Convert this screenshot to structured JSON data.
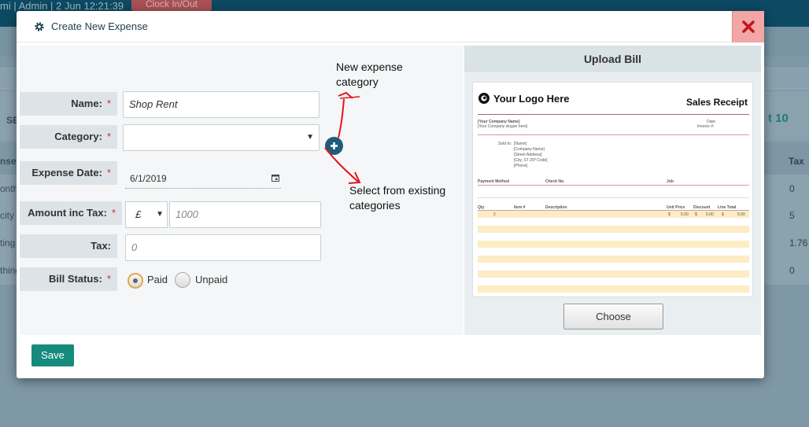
{
  "background": {
    "topbar_text": "mi | Admin | 2 Jun 12:21:39",
    "clock_label": "Clock In/Out",
    "left_fragments": [
      "SE",
      "nse",
      "onth",
      "city",
      "ting",
      "thing"
    ],
    "right_header": "Tax",
    "right_values": [
      "0",
      "5",
      "1.76",
      "0"
    ],
    "stat_fragment": "t 10"
  },
  "modal": {
    "title": "Create New Expense",
    "close_icon": "close-x-icon"
  },
  "form": {
    "name_label": "Name:",
    "name_value": "Shop Rent",
    "category_label": "Category:",
    "category_value": "",
    "date_label": "Expense Date:",
    "date_value": "6/1/2019",
    "amount_label": "Amount inc Tax:",
    "currency_symbol": "£",
    "amount_placeholder": "1000",
    "tax_label": "Tax:",
    "tax_placeholder": "0",
    "status_label": "Bill Status:",
    "status_options": [
      "Paid",
      "Unpaid"
    ],
    "status_selected": "Paid",
    "required_mark": "*",
    "save_label": "Save"
  },
  "annotations": {
    "new_category_line1": "New expense",
    "new_category_line2": "category",
    "existing_line1": "Select from existing",
    "existing_line2": "categories"
  },
  "upload": {
    "title": "Upload Bill",
    "choose_label": "Choose",
    "receipt": {
      "logo_text": "Your Logo Here",
      "title": "Sales Receipt",
      "company": "[Your Company Name]",
      "slogan": "[Your Company slogan here]",
      "date_label": "Date:",
      "invoice_label": "Invoice #:",
      "sold_to": "Sold to:",
      "sold_lines": [
        "[Name]",
        "[Company Name]",
        "[Street Address]",
        "[City, ST ZIP Code]",
        "[Phone]"
      ],
      "payment_headers": [
        "Payment Method",
        "Check No.",
        "Job"
      ],
      "item_headers": [
        "Qty",
        "Item #",
        "Description",
        "Unit Price",
        "Discount",
        "Line Total"
      ],
      "row_values": [
        "2",
        "$",
        "5.00",
        "$",
        "5.00",
        "$",
        "5.00"
      ]
    }
  },
  "colors": {
    "accent": "#168a7c",
    "header_dark": "#0c4a63",
    "close_bg": "#f2a6a6",
    "close_x": "#c0161b",
    "annotation_arrow": "#e0161b"
  }
}
